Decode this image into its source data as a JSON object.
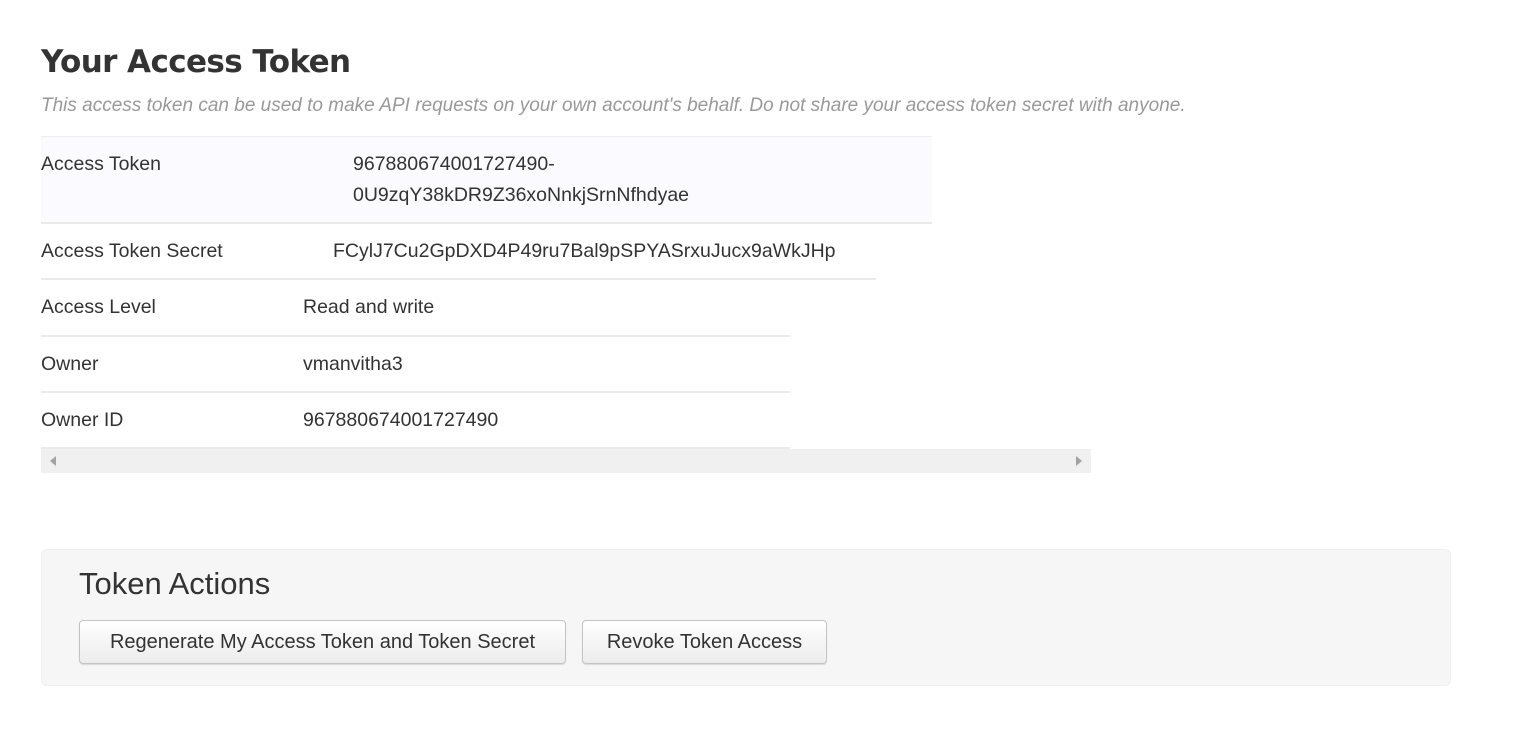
{
  "header": {
    "title": "Your Access Token",
    "subtitle": "This access token can be used to make API requests on your own account's behalf. Do not share your access token secret with anyone."
  },
  "token_table": {
    "rows": [
      {
        "label": "Access Token",
        "value_line1": "967880674001727490-",
        "value_line2": "0U9zqY38kDR9Z36xoNnkjSrnNfhdyae"
      },
      {
        "label": "Access Token Secret",
        "value": "FCylJ7Cu2GpDXD4P49ru7Bal9pSPYASrxuJucx9aWkJHp"
      },
      {
        "label": "Access Level",
        "value": "Read and write"
      },
      {
        "label": "Owner",
        "value": "vmanvitha3"
      },
      {
        "label": "Owner ID",
        "value": "967880674001727490"
      }
    ]
  },
  "actions": {
    "title": "Token Actions",
    "regenerate_label": "Regenerate My Access Token and Token Secret",
    "revoke_label": "Revoke Token Access"
  },
  "icons": {
    "scroll_left": "chevron-left-icon",
    "scroll_right": "chevron-right-icon"
  },
  "colors": {
    "token_row_bg": "#fafaff",
    "subtitle": "#999999",
    "actions_panel_bg": "#f6f6f6"
  }
}
